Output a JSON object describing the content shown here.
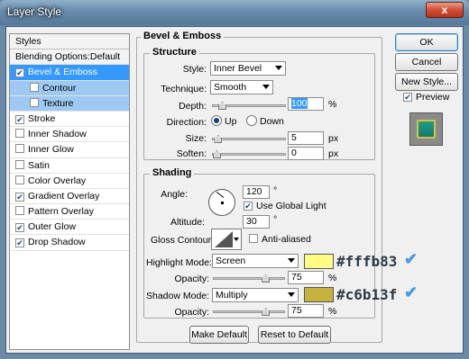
{
  "window": {
    "title": "Layer Style",
    "close_label": "x"
  },
  "styles_list": {
    "header": "Styles",
    "items": [
      {
        "label": "Blending Options:Default",
        "checked": null,
        "state": "header"
      },
      {
        "label": "Bevel & Emboss",
        "checked": true,
        "state": "selected"
      },
      {
        "label": "Contour",
        "checked": false,
        "state": "sub"
      },
      {
        "label": "Texture",
        "checked": false,
        "state": "sub"
      },
      {
        "label": "Stroke",
        "checked": true,
        "state": ""
      },
      {
        "label": "Inner Shadow",
        "checked": false,
        "state": ""
      },
      {
        "label": "Inner Glow",
        "checked": false,
        "state": ""
      },
      {
        "label": "Satin",
        "checked": false,
        "state": ""
      },
      {
        "label": "Color Overlay",
        "checked": false,
        "state": ""
      },
      {
        "label": "Gradient Overlay",
        "checked": true,
        "state": ""
      },
      {
        "label": "Pattern Overlay",
        "checked": false,
        "state": ""
      },
      {
        "label": "Outer Glow",
        "checked": true,
        "state": ""
      },
      {
        "label": "Drop Shadow",
        "checked": true,
        "state": ""
      }
    ]
  },
  "bevel": {
    "title": "Bevel & Emboss",
    "structure": {
      "title": "Structure",
      "style_label": "Style:",
      "style_value": "Inner Bevel",
      "technique_label": "Technique:",
      "technique_value": "Smooth",
      "depth_label": "Depth:",
      "depth_value": "100",
      "depth_unit": "%",
      "depth_level": 0.08,
      "direction_label": "Direction:",
      "dir_up": "Up",
      "dir_down": "Down",
      "size_label": "Size:",
      "size_value": "5",
      "size_unit": "px",
      "size_level": 0.02,
      "soften_label": "Soften:",
      "soften_value": "0",
      "soften_unit": "px",
      "soften_level": 0.0
    },
    "shading": {
      "title": "Shading",
      "angle_label": "Angle:",
      "angle_value": "120",
      "angle_unit": "°",
      "global_light_label": "Use Global Light",
      "global_light": true,
      "altitude_label": "Altitude:",
      "altitude_value": "30",
      "altitude_unit": "°",
      "gloss_label": "Gloss Contour:",
      "anti_aliased_label": "Anti-aliased",
      "anti_aliased": false,
      "highlight_mode_label": "Highlight Mode:",
      "highlight_mode": "Screen",
      "highlight_opacity_label": "Opacity:",
      "highlight_opacity": "75",
      "highlight_opacity_unit": "%",
      "highlight_color": "#fffb83",
      "highlight_hex": "#fffb83",
      "shadow_mode_label": "Shadow Mode:",
      "shadow_mode": "Multiply",
      "shadow_opacity_label": "Opacity:",
      "shadow_opacity": "75",
      "shadow_opacity_unit": "%",
      "shadow_color": "#c6b13f",
      "shadow_hex": "#c6b13f",
      "opacity_level": 0.75
    },
    "make_default": "Make Default",
    "reset_default": "Reset to Default"
  },
  "actions": {
    "ok": "OK",
    "cancel": "Cancel",
    "new_style": "New Style...",
    "preview_label": "Preview",
    "preview": true
  },
  "colors": {
    "preview_fill": "#1f9c88",
    "preview_border": "#d4c440",
    "tick": "#4a9be0"
  }
}
